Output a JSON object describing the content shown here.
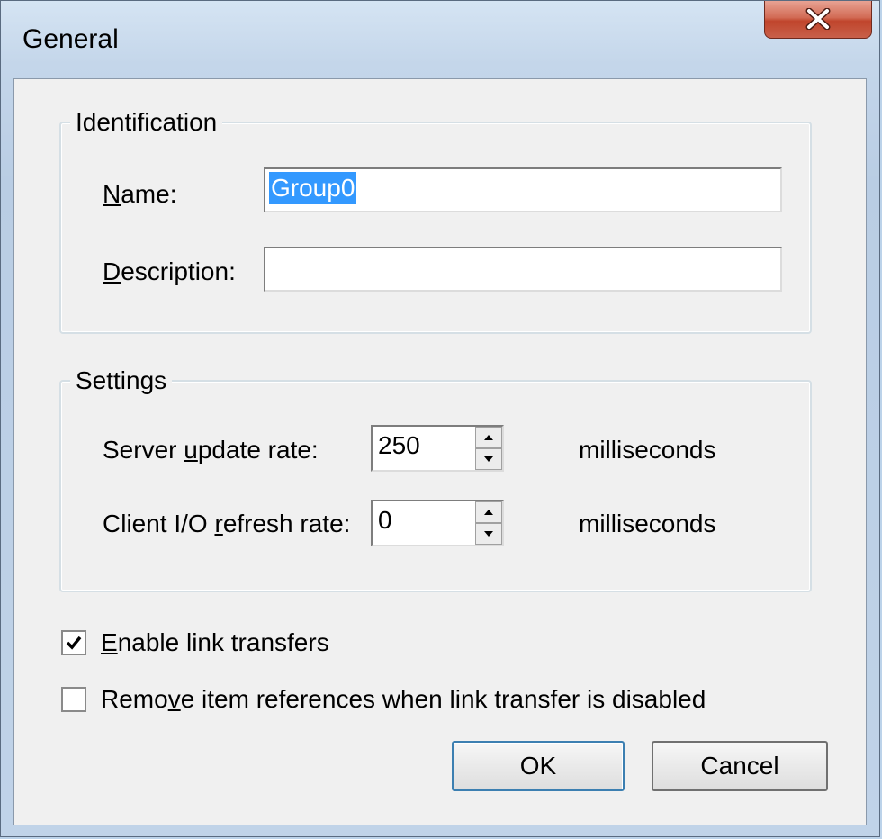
{
  "window": {
    "title": "General",
    "close_glyph": "close-icon"
  },
  "identification": {
    "legend": "Identification",
    "name_label_u": "N",
    "name_label_rest": "ame:",
    "name_value": "Group0",
    "description_label_u": "D",
    "description_label_rest": "escription:",
    "description_value": ""
  },
  "settings": {
    "legend": "Settings",
    "server_label_pre": "Server ",
    "server_label_u": "u",
    "server_label_post": "pdate rate:",
    "server_value": "250",
    "server_unit": "milliseconds",
    "client_label_pre": "Client I/O ",
    "client_label_u": "r",
    "client_label_post": "efresh rate:",
    "client_value": "0",
    "client_unit": "milliseconds"
  },
  "options": {
    "enable_link_u": "E",
    "enable_link_rest": "nable link transfers",
    "enable_link_checked": true,
    "remove_refs_pre": "Remo",
    "remove_refs_u": "v",
    "remove_refs_post": "e item references when link transfer is disabled",
    "remove_refs_checked": false
  },
  "buttons": {
    "ok": "OK",
    "cancel": "Cancel"
  }
}
